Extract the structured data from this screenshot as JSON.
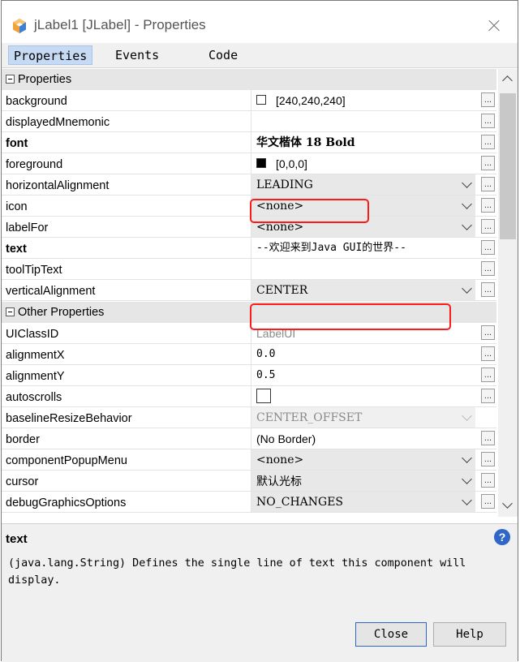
{
  "window": {
    "title": "jLabel1 [JLabel] - Properties"
  },
  "tabs": [
    {
      "label": "Properties"
    },
    {
      "label": "Events"
    },
    {
      "label": "Code"
    }
  ],
  "sections": {
    "properties": "Properties",
    "other": "Other Properties"
  },
  "rows": [
    {
      "name": "background",
      "value": "[240,240,240]"
    },
    {
      "name": "displayedMnemonic",
      "value": ""
    },
    {
      "name": "font",
      "value": "华文楷体 18 Bold"
    },
    {
      "name": "foreground",
      "value": "[0,0,0]"
    },
    {
      "name": "horizontalAlignment",
      "value": "LEADING"
    },
    {
      "name": "icon",
      "value": "<none>"
    },
    {
      "name": "labelFor",
      "value": "<none>"
    },
    {
      "name": "text",
      "value": "--欢迎来到Java GUI的世界--"
    },
    {
      "name": "toolTipText",
      "value": ""
    },
    {
      "name": "verticalAlignment",
      "value": "CENTER"
    }
  ],
  "other_rows": [
    {
      "name": "UIClassID",
      "value": "LabelUI"
    },
    {
      "name": "alignmentX",
      "value": "0.0"
    },
    {
      "name": "alignmentY",
      "value": "0.5"
    },
    {
      "name": "autoscrolls",
      "value": ""
    },
    {
      "name": "baselineResizeBehavior",
      "value": "CENTER_OFFSET"
    },
    {
      "name": "border",
      "value": "(No Border)"
    },
    {
      "name": "componentPopupMenu",
      "value": "<none>"
    },
    {
      "name": "cursor",
      "value": "默认光标"
    },
    {
      "name": "debugGraphicsOptions",
      "value": "NO_CHANGES"
    }
  ],
  "ellipsis": "...",
  "description": {
    "title": "text",
    "text": "(java.lang.String) Defines the single line of text this component will display."
  },
  "buttons": {
    "close": "Close",
    "help": "Help"
  },
  "colors": {
    "accent": "#2e67c7",
    "highlight": "#ff1a1a",
    "tab_active": "#c7daf3"
  },
  "icons": {
    "app": "netbeans-cube-icon",
    "help": "question-icon",
    "close": "close-icon"
  }
}
